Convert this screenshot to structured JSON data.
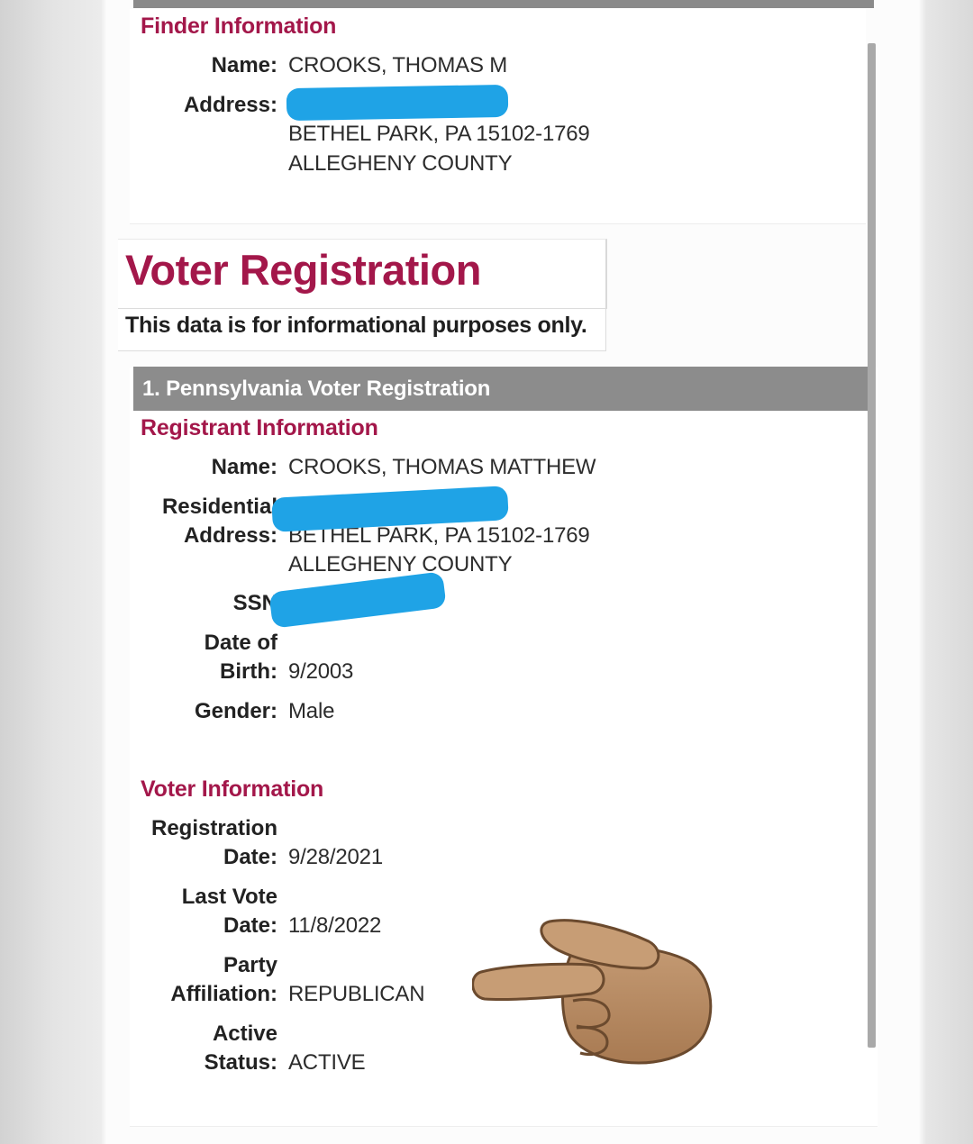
{
  "finder": {
    "section_title": "Finder Information",
    "name_label": "Name:",
    "name_value": "CROOKS, THOMAS M",
    "address_label": "Address:",
    "address_line2": "BETHEL PARK, PA 15102-1769",
    "address_line3": "ALLEGHENY COUNTY"
  },
  "voter": {
    "heading": "Voter Registration",
    "disclaimer": "This data is for informational purposes only.",
    "record_header": "1. Pennsylvania Voter Registration",
    "registrant_title": "Registrant Information",
    "name_label": "Name:",
    "name_value": "CROOKS, THOMAS MATTHEW",
    "residential_label_1": "Residential",
    "residential_label_2": "Address:",
    "residential_line2": "BETHEL PARK, PA 15102-1769",
    "residential_line3": "ALLEGHENY COUNTY",
    "ssn_label": "SSN",
    "dob_label_1": "Date of",
    "dob_label_2": "Birth:",
    "dob_value": "9/2003",
    "gender_label": "Gender:",
    "gender_value": "Male",
    "voter_info_title": "Voter Information",
    "reg_label_1": "Registration",
    "reg_label_2": "Date:",
    "reg_value": "9/28/2021",
    "last_vote_label_1": "Last Vote",
    "last_vote_label_2": "Date:",
    "last_vote_value": "11/8/2022",
    "party_label_1": "Party",
    "party_label_2": "Affiliation:",
    "party_value": "REPUBLICAN",
    "status_label_1": "Active",
    "status_label_2": "Status:",
    "status_value": "ACTIVE"
  },
  "overlay": {
    "pointing_hand_emoji": "pointing-hand-icon",
    "redaction_color": "#1fa3e6"
  },
  "colors": {
    "accent": "#a3174a",
    "header_gray": "#8c8c8c"
  }
}
